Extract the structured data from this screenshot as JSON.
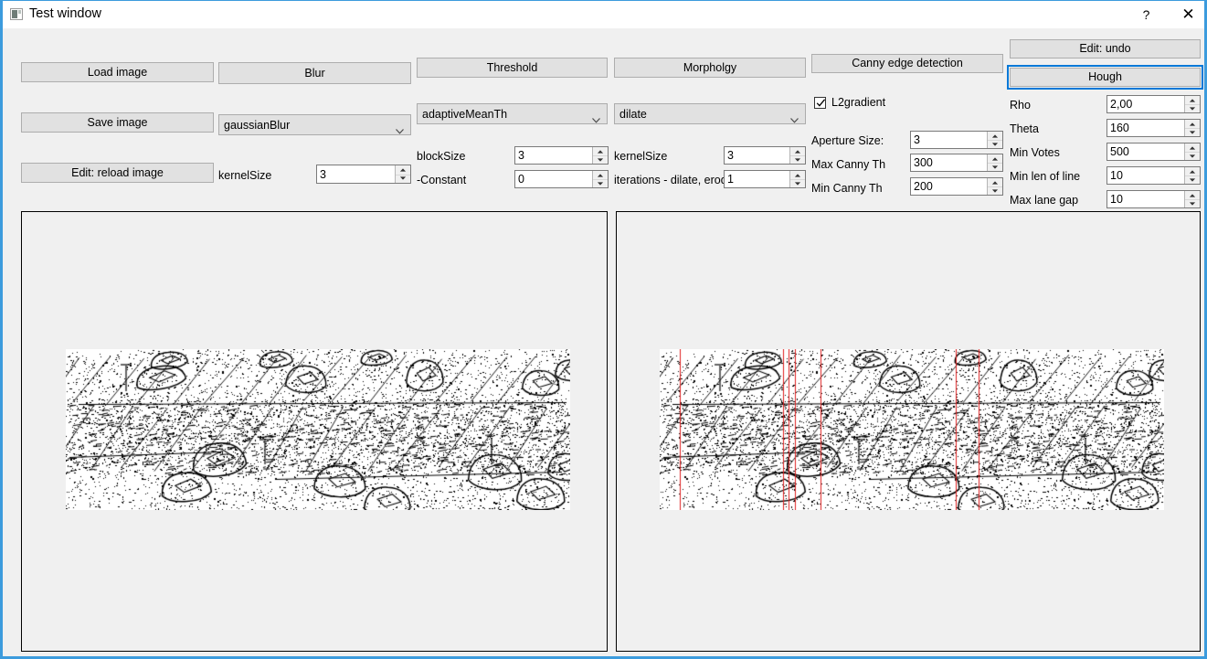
{
  "window": {
    "title": "Test window",
    "icon": "window-icon",
    "help_label": "?",
    "close_label": "✕",
    "accent_border": "#3c9bdd",
    "titlebar_bg": "#ffffff",
    "body_bg": "#f0f0f0"
  },
  "file_actions": {
    "load_label": "Load image",
    "save_label": "Save image",
    "reload_label": "Edit: reload image"
  },
  "blur": {
    "button_label": "Blur",
    "method_value": "gaussianBlur",
    "method_options": [
      "gaussianBlur"
    ],
    "kernel_label": "kernelSize",
    "kernel_value": "3"
  },
  "threshold": {
    "button_label": "Threshold",
    "method_value": "adaptiveMeanTh",
    "method_options": [
      "adaptiveMeanTh"
    ],
    "blocksize_label": "blockSize",
    "blocksize_value": "3",
    "constant_label": "-Constant",
    "constant_value": "0"
  },
  "morphology": {
    "button_label": "Morpholgy",
    "method_value": "dilate",
    "method_options": [
      "dilate"
    ],
    "kernel_label": "kernelSize",
    "kernel_value": "3",
    "iterations_label": "iterations - dilate, erode",
    "iterations_value": "1"
  },
  "canny": {
    "button_label": "Canny edge detection",
    "l2gradient_label": "L2gradient",
    "l2gradient_checked": true,
    "aperture_label": "Aperture Size:",
    "aperture_value": "3",
    "max_th_label": "Max Canny Th",
    "max_th_value": "300",
    "min_th_label": "Min Canny Th",
    "min_th_value": "200"
  },
  "hough": {
    "undo_label": "Edit: undo",
    "button_label": "Hough",
    "button_focused": true,
    "focus_color": "#0078d7",
    "rho_label": "Rho",
    "rho_value": "2,00",
    "theta_label": "Theta",
    "theta_value": "160",
    "min_votes_label": "Min Votes",
    "min_votes_value": "500",
    "min_len_label": "Min len of line",
    "min_len_value": "10",
    "max_gap_label": "Max lane gap",
    "max_gap_value": "10"
  },
  "icons": {
    "chevron_down": "chevron-down-icon",
    "spinner_up": "spinner-up-icon",
    "spinner_down": "spinner-down-icon",
    "checkmark": "checkmark-icon"
  },
  "preview": {
    "left_panel_name": "source-edges-preview",
    "right_panel_name": "hough-lines-preview",
    "line_color": "#e02020",
    "edge_color": "#000000",
    "background": "#ffffff",
    "hough_lines_x": [
      22,
      135,
      141,
      148,
      176,
      324,
      349
    ]
  }
}
